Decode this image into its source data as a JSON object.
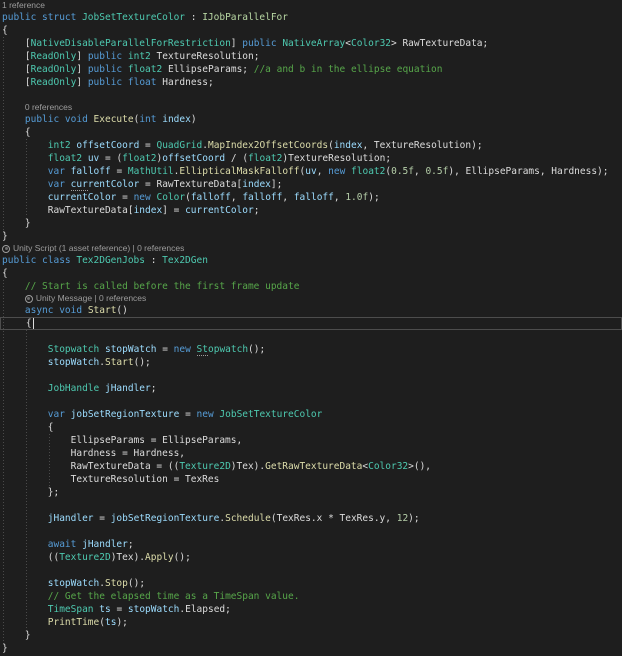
{
  "editor": {
    "language": "C#",
    "theme_colors": {
      "background": "#1e1e1e",
      "keyword": "#569cd6",
      "type": "#4ec9b0",
      "interface": "#b8d7a3",
      "method": "#dcdcaa",
      "variable": "#9cdcfe",
      "number": "#b5cea8",
      "comment": "#57a64a",
      "plain": "#dcdcdc",
      "codelens": "#9d9d9d"
    }
  },
  "code": {
    "lines": [
      {
        "kind": "lens",
        "indent": 0,
        "text": "1 reference"
      },
      {
        "kind": "code",
        "tokens": [
          [
            "k",
            "public struct "
          ],
          [
            "t",
            "JobSetTextureColor"
          ],
          [
            "p",
            " : "
          ],
          [
            "i",
            "IJobParallelFor"
          ]
        ]
      },
      {
        "kind": "code",
        "tokens": [
          [
            "p",
            "{"
          ]
        ]
      },
      {
        "kind": "code",
        "tokens": [
          [
            "p",
            "    ["
          ],
          [
            "t",
            "NativeDisableParallelForRestriction"
          ],
          [
            "p",
            "] "
          ],
          [
            "k",
            "public"
          ],
          [
            "p",
            " "
          ],
          [
            "t",
            "NativeArray"
          ],
          [
            "p",
            "<"
          ],
          [
            "t",
            "Color32"
          ],
          [
            "p",
            "> RawTextureData;"
          ]
        ]
      },
      {
        "kind": "code",
        "tokens": [
          [
            "p",
            "    ["
          ],
          [
            "t",
            "ReadOnly"
          ],
          [
            "p",
            "] "
          ],
          [
            "k",
            "public"
          ],
          [
            "p",
            " "
          ],
          [
            "t",
            "int2"
          ],
          [
            "p",
            " TextureResolution;"
          ]
        ]
      },
      {
        "kind": "code",
        "tokens": [
          [
            "p",
            "    ["
          ],
          [
            "t",
            "ReadOnly"
          ],
          [
            "p",
            "] "
          ],
          [
            "k",
            "public"
          ],
          [
            "p",
            " "
          ],
          [
            "t",
            "float2"
          ],
          [
            "p",
            " EllipseParams; "
          ],
          [
            "c",
            "//a and b in the ellipse equation"
          ]
        ]
      },
      {
        "kind": "code",
        "tokens": [
          [
            "p",
            "    ["
          ],
          [
            "t",
            "ReadOnly"
          ],
          [
            "p",
            "] "
          ],
          [
            "k",
            "public"
          ],
          [
            "p",
            " "
          ],
          [
            "k",
            "float"
          ],
          [
            "p",
            " Hardness;"
          ]
        ]
      },
      {
        "kind": "blank"
      },
      {
        "kind": "lens",
        "indent": 4,
        "text": "0 references"
      },
      {
        "kind": "code",
        "tokens": [
          [
            "p",
            "    "
          ],
          [
            "k",
            "public void "
          ],
          [
            "m",
            "Execute"
          ],
          [
            "p",
            "("
          ],
          [
            "k",
            "int"
          ],
          [
            "p",
            " "
          ],
          [
            "v",
            "index"
          ],
          [
            "p",
            ")"
          ]
        ]
      },
      {
        "kind": "code",
        "tokens": [
          [
            "p",
            "    {"
          ]
        ]
      },
      {
        "kind": "code",
        "tokens": [
          [
            "p",
            "        "
          ],
          [
            "t",
            "int2"
          ],
          [
            "p",
            " "
          ],
          [
            "v",
            "offsetCoord"
          ],
          [
            "p",
            " = "
          ],
          [
            "t",
            "QuadGrid"
          ],
          [
            "p",
            "."
          ],
          [
            "m",
            "MapIndex2OffsetCoords"
          ],
          [
            "p",
            "("
          ],
          [
            "v",
            "index"
          ],
          [
            "p",
            ", TextureResolution);"
          ]
        ]
      },
      {
        "kind": "code",
        "tokens": [
          [
            "p",
            "        "
          ],
          [
            "t",
            "float2"
          ],
          [
            "p",
            " "
          ],
          [
            "v",
            "uv"
          ],
          [
            "p",
            " = ("
          ],
          [
            "t",
            "float2"
          ],
          [
            "p",
            ")"
          ],
          [
            "v",
            "offsetCoord"
          ],
          [
            "p",
            " / ("
          ],
          [
            "t",
            "float2"
          ],
          [
            "p",
            ")TextureResolution;"
          ]
        ]
      },
      {
        "kind": "code",
        "tokens": [
          [
            "p",
            "        "
          ],
          [
            "k",
            "var"
          ],
          [
            "p",
            " "
          ],
          [
            "v",
            "falloff"
          ],
          [
            "p",
            " = "
          ],
          [
            "t",
            "MathUtil"
          ],
          [
            "p",
            "."
          ],
          [
            "m",
            "EllipticalMaskFalloff"
          ],
          [
            "p",
            "("
          ],
          [
            "v",
            "uv"
          ],
          [
            "p",
            ", "
          ],
          [
            "k",
            "new"
          ],
          [
            "p",
            " "
          ],
          [
            "t",
            "float2"
          ],
          [
            "p",
            "("
          ],
          [
            "n",
            "0.5f"
          ],
          [
            "p",
            ", "
          ],
          [
            "n",
            "0.5f"
          ],
          [
            "p",
            "), EllipseParams, Hardness);"
          ]
        ]
      },
      {
        "kind": "code",
        "tokens": [
          [
            "p",
            "        "
          ],
          [
            "k",
            "var"
          ],
          [
            "p",
            " "
          ],
          [
            "v d",
            "cur"
          ],
          [
            "v",
            "rentColor"
          ],
          [
            "p",
            " = RawTextureData["
          ],
          [
            "v",
            "index"
          ],
          [
            "p",
            "];"
          ]
        ]
      },
      {
        "kind": "code",
        "tokens": [
          [
            "p",
            "        "
          ],
          [
            "v",
            "currentColor"
          ],
          [
            "p",
            " = "
          ],
          [
            "k",
            "new"
          ],
          [
            "p",
            " "
          ],
          [
            "t",
            "Color"
          ],
          [
            "p",
            "("
          ],
          [
            "v",
            "falloff"
          ],
          [
            "p",
            ", "
          ],
          [
            "v",
            "falloff"
          ],
          [
            "p",
            ", "
          ],
          [
            "v",
            "falloff"
          ],
          [
            "p",
            ", "
          ],
          [
            "n",
            "1.0f"
          ],
          [
            "p",
            ");"
          ]
        ]
      },
      {
        "kind": "code",
        "tokens": [
          [
            "p",
            "        RawTextureData["
          ],
          [
            "v",
            "index"
          ],
          [
            "p",
            "] = "
          ],
          [
            "v",
            "currentColor"
          ],
          [
            "p",
            ";"
          ]
        ]
      },
      {
        "kind": "code",
        "tokens": [
          [
            "p",
            "    }"
          ]
        ]
      },
      {
        "kind": "code",
        "tokens": [
          [
            "p",
            "}"
          ]
        ]
      },
      {
        "kind": "lens",
        "indent": 0,
        "unity": true,
        "text": "Unity Script (1 asset reference) | 0 references"
      },
      {
        "kind": "code",
        "tokens": [
          [
            "k",
            "public class "
          ],
          [
            "t",
            "Tex2DGenJobs"
          ],
          [
            "p",
            " : "
          ],
          [
            "t",
            "Tex2DGen"
          ]
        ]
      },
      {
        "kind": "code",
        "tokens": [
          [
            "p",
            "{"
          ]
        ]
      },
      {
        "kind": "code",
        "tokens": [
          [
            "p",
            "    "
          ],
          [
            "c",
            "// Start is called before the first frame update"
          ]
        ]
      },
      {
        "kind": "lens",
        "indent": 4,
        "unity": true,
        "text": "Unity Message | 0 references"
      },
      {
        "kind": "code",
        "tokens": [
          [
            "p",
            "    "
          ],
          [
            "k",
            "async void "
          ],
          [
            "m",
            "Start"
          ],
          [
            "p",
            "()"
          ]
        ]
      },
      {
        "kind": "code",
        "current": true,
        "tokens": [
          [
            "p",
            "    {"
          ]
        ]
      },
      {
        "kind": "blank"
      },
      {
        "kind": "code",
        "tokens": [
          [
            "p",
            "        "
          ],
          [
            "t",
            "Stopwatch"
          ],
          [
            "p",
            " "
          ],
          [
            "v",
            "stopWatch"
          ],
          [
            "p",
            " = "
          ],
          [
            "k",
            "new"
          ],
          [
            "p",
            " "
          ],
          [
            "t d",
            "St"
          ],
          [
            "t",
            "opwatch"
          ],
          [
            "p",
            "();"
          ]
        ]
      },
      {
        "kind": "code",
        "tokens": [
          [
            "p",
            "        "
          ],
          [
            "v",
            "stopWatch"
          ],
          [
            "p",
            "."
          ],
          [
            "m",
            "Start"
          ],
          [
            "p",
            "();"
          ]
        ]
      },
      {
        "kind": "blank"
      },
      {
        "kind": "code",
        "tokens": [
          [
            "p",
            "        "
          ],
          [
            "t",
            "JobHandle"
          ],
          [
            "p",
            " "
          ],
          [
            "v",
            "jHandler"
          ],
          [
            "p",
            ";"
          ]
        ]
      },
      {
        "kind": "blank"
      },
      {
        "kind": "code",
        "tokens": [
          [
            "p",
            "        "
          ],
          [
            "k",
            "var"
          ],
          [
            "p",
            " "
          ],
          [
            "v",
            "jobSetRegionTexture"
          ],
          [
            "p",
            " = "
          ],
          [
            "k",
            "new"
          ],
          [
            "p",
            " "
          ],
          [
            "t",
            "JobSetTextureColor"
          ]
        ]
      },
      {
        "kind": "code",
        "tokens": [
          [
            "p",
            "        {"
          ]
        ]
      },
      {
        "kind": "code",
        "tokens": [
          [
            "p",
            "            EllipseParams = EllipseParams,"
          ]
        ]
      },
      {
        "kind": "code",
        "tokens": [
          [
            "p",
            "            Hardness = Hardness,"
          ]
        ]
      },
      {
        "kind": "code",
        "tokens": [
          [
            "p",
            "            RawTextureData = (("
          ],
          [
            "t",
            "Texture2D"
          ],
          [
            "p",
            ")Tex)."
          ],
          [
            "m",
            "GetRawTextureData"
          ],
          [
            "p",
            "<"
          ],
          [
            "t",
            "Color32"
          ],
          [
            "p",
            ">(),"
          ]
        ]
      },
      {
        "kind": "code",
        "tokens": [
          [
            "p",
            "            TextureResolution = TexRes"
          ]
        ]
      },
      {
        "kind": "code",
        "tokens": [
          [
            "p",
            "        };"
          ]
        ]
      },
      {
        "kind": "blank"
      },
      {
        "kind": "code",
        "tokens": [
          [
            "p",
            "        "
          ],
          [
            "v",
            "jHandler"
          ],
          [
            "p",
            " = "
          ],
          [
            "v",
            "jobSetRegionTexture"
          ],
          [
            "p",
            "."
          ],
          [
            "m",
            "Schedule"
          ],
          [
            "p",
            "(TexRes.x * TexRes.y, "
          ],
          [
            "n",
            "12"
          ],
          [
            "p",
            ");"
          ]
        ]
      },
      {
        "kind": "blank"
      },
      {
        "kind": "code",
        "tokens": [
          [
            "p",
            "        "
          ],
          [
            "k",
            "await"
          ],
          [
            "p",
            " "
          ],
          [
            "v",
            "jHandler"
          ],
          [
            "p",
            ";"
          ]
        ]
      },
      {
        "kind": "code",
        "tokens": [
          [
            "p",
            "        (("
          ],
          [
            "t",
            "Texture2D"
          ],
          [
            "p",
            ")Tex)."
          ],
          [
            "m",
            "Apply"
          ],
          [
            "p",
            "();"
          ]
        ]
      },
      {
        "kind": "blank"
      },
      {
        "kind": "code",
        "tokens": [
          [
            "p",
            "        "
          ],
          [
            "v",
            "stopWatch"
          ],
          [
            "p",
            "."
          ],
          [
            "m",
            "Stop"
          ],
          [
            "p",
            "();"
          ]
        ]
      },
      {
        "kind": "code",
        "tokens": [
          [
            "p",
            "        "
          ],
          [
            "c",
            "// Get the elapsed time as a TimeSpan value."
          ]
        ]
      },
      {
        "kind": "code",
        "tokens": [
          [
            "p",
            "        "
          ],
          [
            "t",
            "TimeSpan"
          ],
          [
            "p",
            " "
          ],
          [
            "v",
            "ts"
          ],
          [
            "p",
            " = "
          ],
          [
            "v",
            "stopWatch"
          ],
          [
            "p",
            ".Elapsed;"
          ]
        ]
      },
      {
        "kind": "code",
        "tokens": [
          [
            "p",
            "        "
          ],
          [
            "m",
            "PrintTime"
          ],
          [
            "p",
            "("
          ],
          [
            "v",
            "ts"
          ],
          [
            "p",
            ");"
          ]
        ]
      },
      {
        "kind": "code",
        "tokens": [
          [
            "p",
            "    }"
          ]
        ]
      },
      {
        "kind": "code",
        "tokens": [
          [
            "p",
            "}"
          ]
        ]
      }
    ]
  }
}
